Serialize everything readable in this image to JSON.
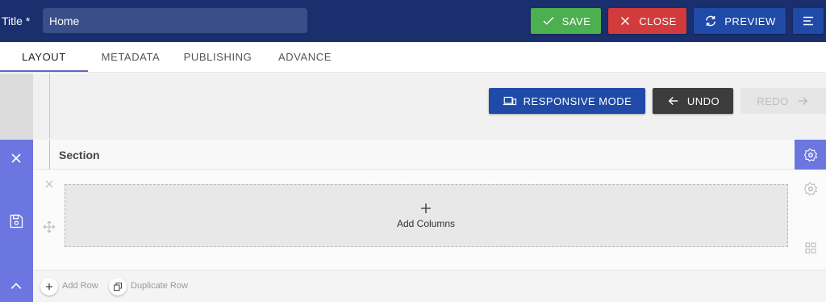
{
  "header": {
    "title_label": "Title *",
    "title_value": "Home",
    "save_label": "SAVE",
    "close_label": "CLOSE",
    "preview_label": "PREVIEW",
    "colors": {
      "bar": "#1b2f6e",
      "save": "#4caf50",
      "close": "#d23b3b",
      "preview": "#1f4aa8"
    }
  },
  "tabs": [
    {
      "label": "LAYOUT",
      "active": true
    },
    {
      "label": "METADATA",
      "active": false
    },
    {
      "label": "PUBLISHING",
      "active": false
    },
    {
      "label": "ADVANCE",
      "active": false
    }
  ],
  "actions": {
    "responsive_label": "RESPONSIVE MODE",
    "undo_label": "UNDO",
    "redo_label": "REDO"
  },
  "section": {
    "title": "Section",
    "add_columns_label": "Add Columns",
    "add_row_label": "Add Row",
    "duplicate_row_label": "Duplicate Row",
    "accent_color": "#6c76e0"
  },
  "icons": [
    "check-icon",
    "close-icon",
    "refresh-icon",
    "menu-icon",
    "devices-icon",
    "arrow-left-icon",
    "arrow-right-icon",
    "save-icon",
    "chevron-up-icon",
    "gear-icon",
    "move-icon",
    "plus-icon",
    "grid-icon",
    "copy-icon"
  ]
}
